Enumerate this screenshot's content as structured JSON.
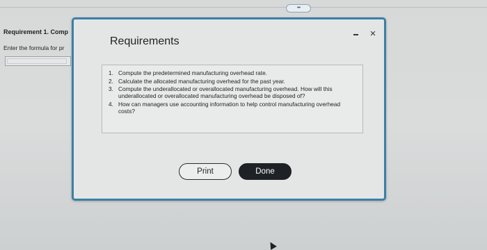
{
  "background": {
    "requirement_heading": "Requirement 1. Comp",
    "formula_instruction": "Enter the formula for pr",
    "formula_input_value": ""
  },
  "toolbar": {
    "more_label": "•••"
  },
  "modal": {
    "title": "Requirements",
    "minimize_symbol": "-",
    "close_symbol": "×",
    "requirements": [
      {
        "number": "1.",
        "text": "Compute the predetermined manufacturing overhead rate."
      },
      {
        "number": "2.",
        "text": "Calculate the allocated manufacturing overhead for the past year."
      },
      {
        "number": "3.",
        "text": "Compute the underallocated or overallocated manufacturing overhead. How will this underallocated or overallocated manufacturing overhead be disposed of?"
      },
      {
        "number": "4.",
        "text": "How can managers use accounting information to help control manufacturing overhead costs?"
      }
    ],
    "buttons": {
      "print": "Print",
      "done": "Done"
    }
  },
  "colors": {
    "modal_border": "#3b7fa6",
    "done_button": "#1e2226"
  }
}
